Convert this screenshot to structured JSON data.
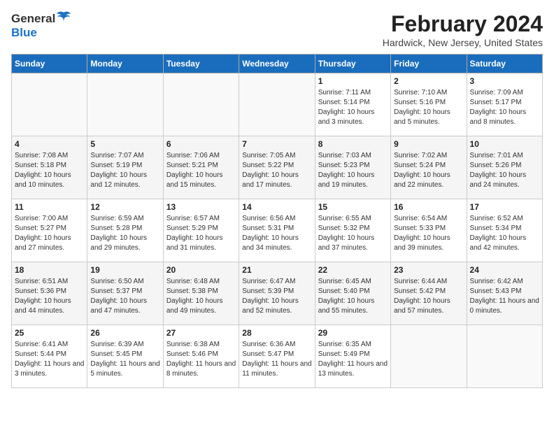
{
  "logo": {
    "general": "General",
    "blue": "Blue"
  },
  "title": "February 2024",
  "subtitle": "Hardwick, New Jersey, United States",
  "days_of_week": [
    "Sunday",
    "Monday",
    "Tuesday",
    "Wednesday",
    "Thursday",
    "Friday",
    "Saturday"
  ],
  "weeks": [
    [
      {
        "day": "",
        "info": ""
      },
      {
        "day": "",
        "info": ""
      },
      {
        "day": "",
        "info": ""
      },
      {
        "day": "",
        "info": ""
      },
      {
        "day": "1",
        "info": "Sunrise: 7:11 AM\nSunset: 5:14 PM\nDaylight: 10 hours\nand 3 minutes."
      },
      {
        "day": "2",
        "info": "Sunrise: 7:10 AM\nSunset: 5:16 PM\nDaylight: 10 hours\nand 5 minutes."
      },
      {
        "day": "3",
        "info": "Sunrise: 7:09 AM\nSunset: 5:17 PM\nDaylight: 10 hours\nand 8 minutes."
      }
    ],
    [
      {
        "day": "4",
        "info": "Sunrise: 7:08 AM\nSunset: 5:18 PM\nDaylight: 10 hours\nand 10 minutes."
      },
      {
        "day": "5",
        "info": "Sunrise: 7:07 AM\nSunset: 5:19 PM\nDaylight: 10 hours\nand 12 minutes."
      },
      {
        "day": "6",
        "info": "Sunrise: 7:06 AM\nSunset: 5:21 PM\nDaylight: 10 hours\nand 15 minutes."
      },
      {
        "day": "7",
        "info": "Sunrise: 7:05 AM\nSunset: 5:22 PM\nDaylight: 10 hours\nand 17 minutes."
      },
      {
        "day": "8",
        "info": "Sunrise: 7:03 AM\nSunset: 5:23 PM\nDaylight: 10 hours\nand 19 minutes."
      },
      {
        "day": "9",
        "info": "Sunrise: 7:02 AM\nSunset: 5:24 PM\nDaylight: 10 hours\nand 22 minutes."
      },
      {
        "day": "10",
        "info": "Sunrise: 7:01 AM\nSunset: 5:26 PM\nDaylight: 10 hours\nand 24 minutes."
      }
    ],
    [
      {
        "day": "11",
        "info": "Sunrise: 7:00 AM\nSunset: 5:27 PM\nDaylight: 10 hours\nand 27 minutes."
      },
      {
        "day": "12",
        "info": "Sunrise: 6:59 AM\nSunset: 5:28 PM\nDaylight: 10 hours\nand 29 minutes."
      },
      {
        "day": "13",
        "info": "Sunrise: 6:57 AM\nSunset: 5:29 PM\nDaylight: 10 hours\nand 31 minutes."
      },
      {
        "day": "14",
        "info": "Sunrise: 6:56 AM\nSunset: 5:31 PM\nDaylight: 10 hours\nand 34 minutes."
      },
      {
        "day": "15",
        "info": "Sunrise: 6:55 AM\nSunset: 5:32 PM\nDaylight: 10 hours\nand 37 minutes."
      },
      {
        "day": "16",
        "info": "Sunrise: 6:54 AM\nSunset: 5:33 PM\nDaylight: 10 hours\nand 39 minutes."
      },
      {
        "day": "17",
        "info": "Sunrise: 6:52 AM\nSunset: 5:34 PM\nDaylight: 10 hours\nand 42 minutes."
      }
    ],
    [
      {
        "day": "18",
        "info": "Sunrise: 6:51 AM\nSunset: 5:36 PM\nDaylight: 10 hours\nand 44 minutes."
      },
      {
        "day": "19",
        "info": "Sunrise: 6:50 AM\nSunset: 5:37 PM\nDaylight: 10 hours\nand 47 minutes."
      },
      {
        "day": "20",
        "info": "Sunrise: 6:48 AM\nSunset: 5:38 PM\nDaylight: 10 hours\nand 49 minutes."
      },
      {
        "day": "21",
        "info": "Sunrise: 6:47 AM\nSunset: 5:39 PM\nDaylight: 10 hours\nand 52 minutes."
      },
      {
        "day": "22",
        "info": "Sunrise: 6:45 AM\nSunset: 5:40 PM\nDaylight: 10 hours\nand 55 minutes."
      },
      {
        "day": "23",
        "info": "Sunrise: 6:44 AM\nSunset: 5:42 PM\nDaylight: 10 hours\nand 57 minutes."
      },
      {
        "day": "24",
        "info": "Sunrise: 6:42 AM\nSunset: 5:43 PM\nDaylight: 11 hours\nand 0 minutes."
      }
    ],
    [
      {
        "day": "25",
        "info": "Sunrise: 6:41 AM\nSunset: 5:44 PM\nDaylight: 11 hours\nand 3 minutes."
      },
      {
        "day": "26",
        "info": "Sunrise: 6:39 AM\nSunset: 5:45 PM\nDaylight: 11 hours\nand 5 minutes."
      },
      {
        "day": "27",
        "info": "Sunrise: 6:38 AM\nSunset: 5:46 PM\nDaylight: 11 hours\nand 8 minutes."
      },
      {
        "day": "28",
        "info": "Sunrise: 6:36 AM\nSunset: 5:47 PM\nDaylight: 11 hours\nand 11 minutes."
      },
      {
        "day": "29",
        "info": "Sunrise: 6:35 AM\nSunset: 5:49 PM\nDaylight: 11 hours\nand 13 minutes."
      },
      {
        "day": "",
        "info": ""
      },
      {
        "day": "",
        "info": ""
      }
    ]
  ]
}
